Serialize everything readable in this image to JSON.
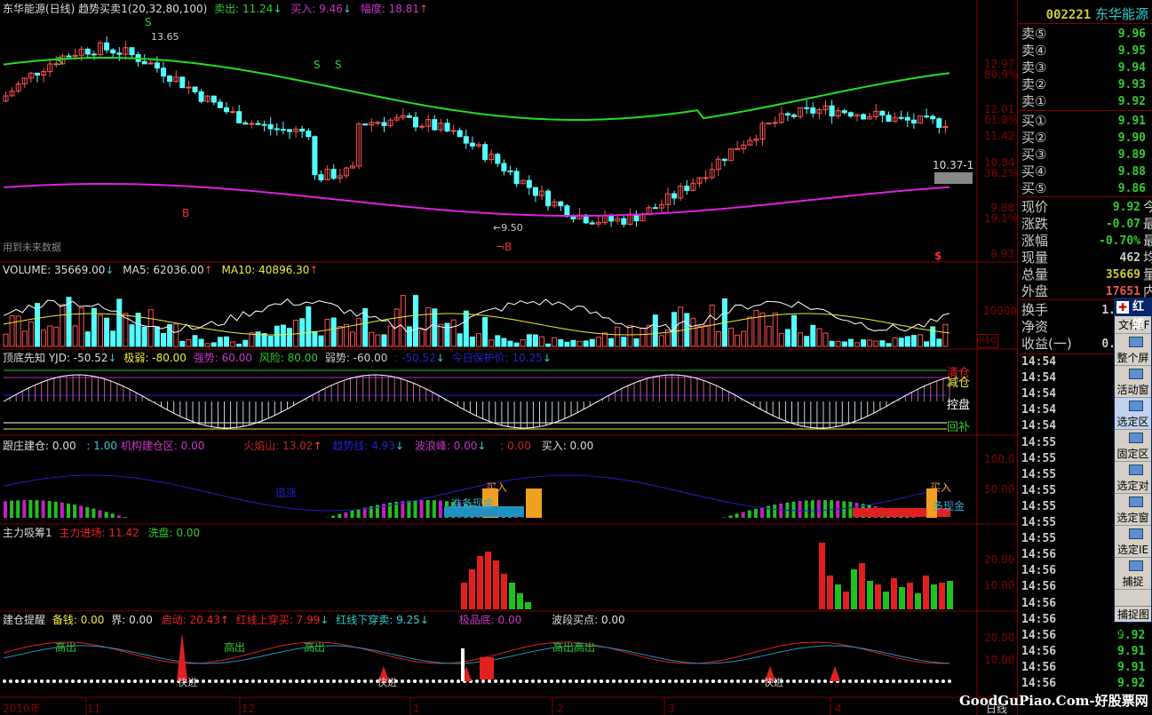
{
  "header": {
    "title": "东华能源(日线) 趋势买卖1(20,32,80,100)",
    "sell_label": "卖出: 11.24",
    "sell_arrow": "↓",
    "buy_label": "买入: 9.46",
    "buy_arrow": "↓",
    "range_label": "幅度: 18.81",
    "range_arrow": "↑"
  },
  "main": {
    "high_mark": "13.65",
    "low_mark": "←9.50",
    "price_tag": "10.37-1",
    "future_note": "用到未来数据",
    "signal_s": "S",
    "signal_b": "B",
    "signal_nb": "¬B",
    "signal_dollar": "$",
    "axis": [
      {
        "v": "12.97",
        "p": "80.9%"
      },
      {
        "v": "12.01",
        "p": "61.8%"
      },
      {
        "v": "11.42",
        "p": ""
      },
      {
        "v": "10.84",
        "p": "38.2%"
      },
      {
        "v": "9.88",
        "p": "19.1%"
      },
      {
        "v": "8.93",
        "p": ""
      }
    ]
  },
  "volume": {
    "label": "VOLUME: 35669.00",
    "a1": "↓",
    "ma5": "MA5: 62036.00",
    "a2": "↑",
    "ma10": "MA10: 40896.30",
    "a3": "↑",
    "axis": "10000",
    "unit": "X10"
  },
  "yjd": {
    "name": "顶底先知",
    "yjd": "YJD: -50.52",
    "a0": "↓",
    "jr": "极弱: -80.00",
    "qs": "强势: 60.00",
    "fx": "风险: 80.00",
    "rs": "弱势: -60.00",
    "v2": ": -50.52",
    "a1": "↓",
    "bh": "今日保护价: 10.25",
    "a2": "↓",
    "qc": "清仓",
    "jc": "减仓",
    "kp": "控盘",
    "hb": "回补"
  },
  "gz": {
    "name": "跟庄建仓",
    "v0": ": 0.00",
    "v1": ": 1.00",
    "jg": "机构建仓区: 0.00",
    "hys": "火焰山: 13.02",
    "a0": "↑",
    "qsx": "趋势线: 4.93",
    "a1": "↓",
    "blf": "波浪峰: 0.00",
    "a2": "↓",
    "v3": ": 0.00",
    "mr": "买入: 0.00",
    "zz": "追涨",
    "mr_tag": "买入",
    "zd": "准备现金",
    "xj": "多现金",
    "axis100": "100.0",
    "axis50": "50.00"
  },
  "zl": {
    "name": "主力吸筹1",
    "jc": "主力进场: 11.42",
    "xp": "洗盘: 0.00",
    "axis20": "20.00",
    "axis10": "10.00"
  },
  "jt": {
    "name": "建仓提醒",
    "bq": "备钱: 0.00",
    "jie": "界: 0.00",
    "qd": "启动: 20.43",
    "a0": "↑",
    "hs": "红线上穿买: 7.99",
    "a1": "↓",
    "hx": "红线下穿卖: 9.25",
    "a2": "↓",
    "jpd": "极品底: 0.00",
    "bd": "波段买点: 0.00",
    "gc": "高出",
    "gcgc": "高出高出",
    "kj": "快进",
    "axis20": "20.00",
    "axis10": "10.00"
  },
  "xaxis": {
    "labels": [
      "2010年",
      "11",
      "12",
      "1",
      "2",
      "3",
      "4"
    ],
    "period": "日线"
  },
  "quote": {
    "code": "002221",
    "name": "东华能源",
    "sells": [
      {
        "k": "卖⑤",
        "v": "9.96"
      },
      {
        "k": "卖④",
        "v": "9.95"
      },
      {
        "k": "卖③",
        "v": "9.94"
      },
      {
        "k": "卖②",
        "v": "9.93"
      },
      {
        "k": "卖①",
        "v": "9.92"
      }
    ],
    "buys": [
      {
        "k": "买①",
        "v": "9.91"
      },
      {
        "k": "买②",
        "v": "9.90"
      },
      {
        "k": "买③",
        "v": "9.89"
      },
      {
        "k": "买④",
        "v": "9.88"
      },
      {
        "k": "买⑤",
        "v": "9.86"
      }
    ],
    "stats": [
      {
        "k": "现价",
        "v": "9.92",
        "x": "今",
        "c": "#3c3"
      },
      {
        "k": "涨跌",
        "v": "-0.07",
        "x": "最",
        "c": "#3c3"
      },
      {
        "k": "涨幅",
        "v": "-0.70%",
        "x": "最",
        "c": "#3c3"
      },
      {
        "k": "现量",
        "v": "462",
        "x": "均",
        "c": "#ccc"
      },
      {
        "k": "总量",
        "v": "35669",
        "x": "量",
        "c": "#cc3"
      },
      {
        "k": "外盘",
        "v": "17651",
        "x": "内",
        "c": "#e55"
      }
    ],
    "extra": [
      {
        "k": "换手",
        "v": "1."
      },
      {
        "k": "净资",
        "v": ""
      },
      {
        "k": "收益(一)",
        "v": "0."
      }
    ],
    "ticks": [
      {
        "t": "14:54"
      },
      {
        "t": "14:54"
      },
      {
        "t": "14:54"
      },
      {
        "t": "14:54"
      },
      {
        "t": "14:54"
      },
      {
        "t": "14:55"
      },
      {
        "t": "14:55"
      },
      {
        "t": "14:55"
      },
      {
        "t": "14:55"
      },
      {
        "t": "14:55"
      },
      {
        "t": "14:55"
      },
      {
        "t": "14:55"
      },
      {
        "t": "14:56"
      },
      {
        "t": "14:56"
      },
      {
        "t": "14:56"
      },
      {
        "t": "14:56"
      },
      {
        "t": "14:56"
      },
      {
        "t": "14:56",
        "p": "9.92"
      },
      {
        "t": "14:56",
        "p": "9.91"
      },
      {
        "t": "14:56",
        "p": "9.91"
      },
      {
        "t": "14:56",
        "p": "9.92"
      }
    ]
  },
  "popup": {
    "title": "红蜻",
    "menu": "文件(F",
    "buttons": [
      "整个屏",
      "活动窗",
      "选定区",
      "固定区",
      "选定对",
      "选定窗",
      "选定IE",
      "捕捉"
    ],
    "status": "捕捉图像"
  },
  "watermark": "GoodGuPiao.Com-好股票网"
}
